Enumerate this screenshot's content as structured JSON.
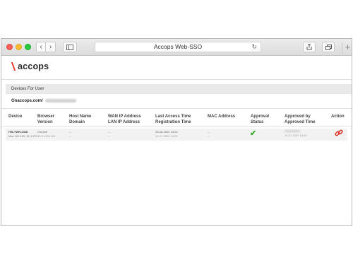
{
  "window": {
    "url_title": "Accops Web-SSO",
    "icons": {
      "back": "chevron-left-icon",
      "forward": "chevron-right-icon",
      "sidebar": "sidebar-icon",
      "reload": "reload-icon",
      "share": "share-icon",
      "tabs": "tabs-icon",
      "new_tab": "plus-icon"
    },
    "colors": {
      "close": "#fc5f57",
      "minimize": "#fdbc2e",
      "zoom": "#28c840"
    }
  },
  "app": {
    "brand": "accops",
    "brand_accent": "#e2352b",
    "section_title": "Devices For User",
    "domain_label": "Onaccops.com/"
  },
  "table": {
    "headers": {
      "device": "Device",
      "browser_version": "Browser\nVersion",
      "host_name_domain": "Host Name\nDomain",
      "wan_lan_ip": "WAN IP Address\nLAN IP Address",
      "access_registration_time": "Last Access Time\nRegistration Time",
      "mac_address": "MAC Address",
      "approval_status": "Approval\nStatus",
      "approved_by_time": "Approved by\nApproved Time",
      "action": "Action"
    },
    "rows": [
      {
        "device_name": "HW-TWR-ODB",
        "device_sub": "Mac OS X10_15_6 PC",
        "browser": "Chrome",
        "browser_version": "83.0.4103.116",
        "host_name": "--",
        "domain": "--",
        "wan_ip": "--",
        "lan_ip": "--",
        "last_access": "23-08-2020 13:02",
        "registration": "14-07-2020 14:00",
        "mac_address": "--",
        "mac_sub": "--",
        "approved_time": "14-07-2020 14:00",
        "approval_status_icon": "check-icon",
        "approval_color": "#3aaa35",
        "action_icon": "unlink-icon",
        "action_color": "#d9281e"
      }
    ]
  }
}
